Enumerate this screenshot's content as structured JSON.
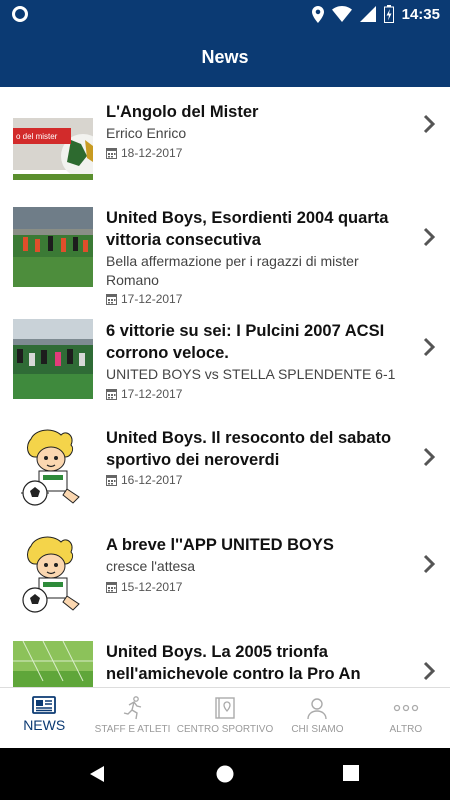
{
  "status_bar": {
    "time": "14:35"
  },
  "app_bar": {
    "title": "News"
  },
  "news": [
    {
      "title": "L'Angolo del Mister",
      "subtitle": "Errico Enrico",
      "date": "18-12-2017",
      "thumb_caption": "o del mister"
    },
    {
      "title": "United Boys, Esordienti 2004 quarta vittoria consecutiva",
      "subtitle": "Bella affermazione per i ragazzi di mister Romano",
      "date": "17-12-2017"
    },
    {
      "title": "6 vittorie su sei: I Pulcini 2007 ACSI corrono veloce.",
      "subtitle": "UNITED BOYS vs STELLA SPLENDENTE 6-1",
      "date": "17-12-2017"
    },
    {
      "title": "United Boys. Il resoconto del sabato sportivo dei neroverdi",
      "subtitle": "",
      "date": "16-12-2017"
    },
    {
      "title": "A breve l''APP UNITED BOYS",
      "subtitle": "cresce l'attesa",
      "date": "15-12-2017"
    },
    {
      "title": "United Boys. La 2005 trionfa nell'amichevole contro la Pro An",
      "subtitle": "",
      "date": ""
    }
  ],
  "bottom_nav": [
    {
      "label": "NEWS",
      "icon": "newspaper-icon",
      "active": true
    },
    {
      "label": "STAFF E ATLETI",
      "icon": "runner-icon",
      "active": false
    },
    {
      "label": "CENTRO SPORTIVO",
      "icon": "map-book-icon",
      "active": false
    },
    {
      "label": "CHI SIAMO",
      "icon": "person-icon",
      "active": false
    },
    {
      "label": "ALTRO",
      "icon": "more-dots-icon",
      "active": false
    }
  ],
  "colors": {
    "primary": "#0b3a73",
    "chevron": "#555555"
  }
}
